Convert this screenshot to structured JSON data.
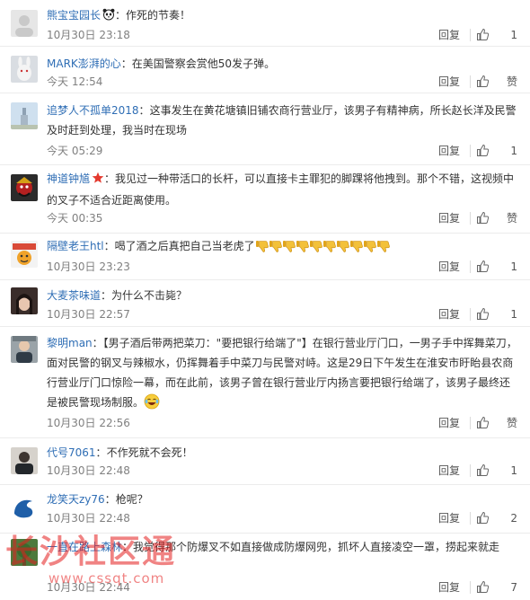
{
  "actions": {
    "reply_label": "回复",
    "like_default": "赞"
  },
  "colors": {
    "username": "#2f6eb5",
    "meta": "#808080",
    "watermark": "#e41e1e"
  },
  "comments": [
    {
      "user": "熊宝宝园长",
      "badge": "panda-icon",
      "sep": "：",
      "text": "作死的节奏！",
      "time": "10月30日 23:18",
      "likes": "1"
    },
    {
      "user": "MARK澎湃的心",
      "sep": "：",
      "text": "在美国警察会赏他50发子弹。",
      "time": "今天 12:54",
      "likes": "赞"
    },
    {
      "user": "追梦人不孤单2018",
      "sep": "：",
      "text": "这事发生在黄花塘镇旧铺农商行营业厅，该男子有精神病，所长赵长洋及民警及时赶到处理，我当时在现场",
      "time": "今天 05:29",
      "likes": "1"
    },
    {
      "user": "神道钟馗",
      "badge": "red-star-icon",
      "sep": "：",
      "text": "我见过一种带活口的长杆，可以直接卡主罪犯的脚踝将他拽到。那个不错，这视频中的叉子不适合近距离使用。",
      "time": "今天 00:35",
      "likes": "赞"
    },
    {
      "user": "隔壁老王htl",
      "sep": "：",
      "text": "喝了酒之后真把自己当老虎了",
      "emoji": "thumbs-down-icon x10",
      "time": "10月30日 23:23",
      "likes": "1"
    },
    {
      "user": "大麦茶味道",
      "sep": "：",
      "text": "为什么不击毙？",
      "time": "10月30日 22:57",
      "likes": "1"
    },
    {
      "user": "黎明man",
      "sep": "：",
      "text": "【男子酒后带两把菜刀：\"要把银行给端了\"】在银行营业厅门口，一男子手中挥舞菜刀，面对民警的钢叉与辣椒水，仍挥舞着手中菜刀与民警对峙。这是29日下午发生在淮安市盱眙县农商行营业厅门口惊险一幕，而在此前，该男子曾在银行营业厅内扬言要把银行给端了，该男子最终还是被民警现场制服。",
      "emoji": "laughing-tears-icon",
      "time": "10月30日 22:56",
      "likes": "赞"
    },
    {
      "user": "代号7061",
      "sep": "：",
      "text": "不作死就不会死！",
      "time": "10月30日 22:48",
      "likes": "1"
    },
    {
      "user": "龙笑天zy76",
      "sep": "：",
      "text": "枪呢？",
      "time": "10月30日 22:48",
      "likes": "2"
    },
    {
      "user": "一直在路上森林",
      "sep": "：",
      "text": "我觉得那个防爆叉不如直接做成防爆网兜，抓坏人直接凌空一罩，捞起来就走",
      "time": "10月30日 22:44",
      "likes": "7"
    }
  ],
  "watermark": {
    "site_name": "长沙社区通",
    "url": "www.cssqt.com"
  }
}
